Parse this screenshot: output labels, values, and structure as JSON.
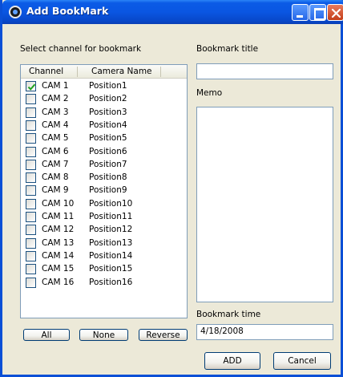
{
  "window": {
    "title": "Add BookMark"
  },
  "channels": {
    "section_label": "Select channel for bookmark",
    "columns": [
      "Channel",
      "Camera Name"
    ],
    "rows": [
      {
        "channel": "CAM 1",
        "camera": "Position1",
        "checked": true
      },
      {
        "channel": "CAM 2",
        "camera": "Position2",
        "checked": false
      },
      {
        "channel": "CAM 3",
        "camera": "Position3",
        "checked": false
      },
      {
        "channel": "CAM 4",
        "camera": "Position4",
        "checked": false
      },
      {
        "channel": "CAM 5",
        "camera": "Position5",
        "checked": false
      },
      {
        "channel": "CAM 6",
        "camera": "Position6",
        "checked": false
      },
      {
        "channel": "CAM 7",
        "camera": "Position7",
        "checked": false
      },
      {
        "channel": "CAM 8",
        "camera": "Position8",
        "checked": false
      },
      {
        "channel": "CAM 9",
        "camera": "Position9",
        "checked": false
      },
      {
        "channel": "CAM 10",
        "camera": "Position10",
        "checked": false
      },
      {
        "channel": "CAM 11",
        "camera": "Position11",
        "checked": false
      },
      {
        "channel": "CAM 12",
        "camera": "Position12",
        "checked": false
      },
      {
        "channel": "CAM 13",
        "camera": "Position13",
        "checked": false
      },
      {
        "channel": "CAM 14",
        "camera": "Position14",
        "checked": false
      },
      {
        "channel": "CAM 15",
        "camera": "Position15",
        "checked": false
      },
      {
        "channel": "CAM 16",
        "camera": "Position16",
        "checked": false
      }
    ],
    "buttons": {
      "all": "All",
      "none": "None",
      "reverse": "Reverse"
    }
  },
  "bookmark": {
    "title_label": "Bookmark title",
    "title_value": "",
    "memo_label": "Memo",
    "memo_value": "",
    "time_label": "Bookmark time",
    "time_value": "4/18/2008"
  },
  "actions": {
    "add": "ADD",
    "cancel": "Cancel"
  },
  "colors": {
    "titlebar": "#0a56e2",
    "frame": "#0a4fd6",
    "dialog_bg": "#ece9d8",
    "field_border": "#7f9db9",
    "check": "#21a121"
  }
}
